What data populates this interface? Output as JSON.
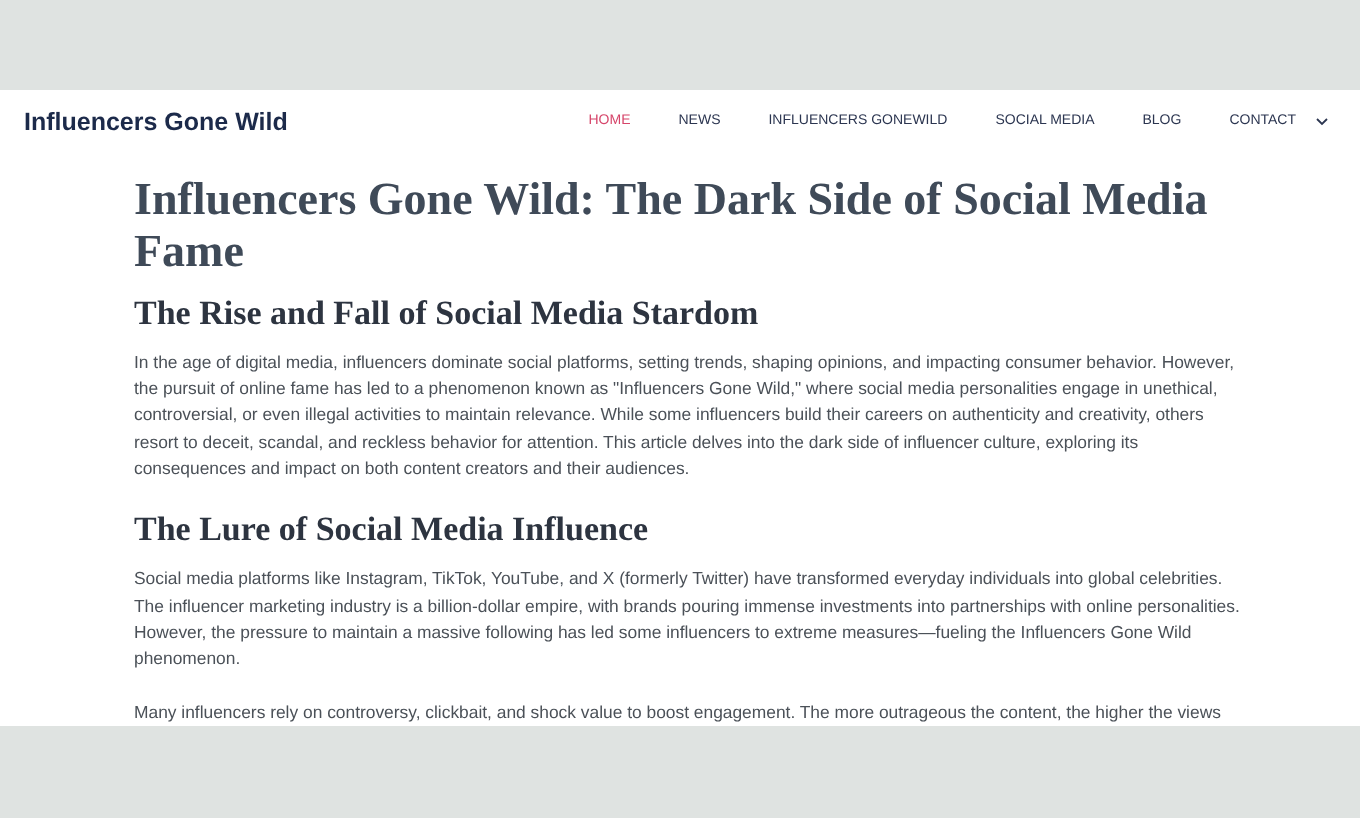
{
  "site_title": "Influencers Gone Wild",
  "nav": [
    {
      "label": "HOME",
      "selected": true
    },
    {
      "label": "NEWS",
      "selected": false
    },
    {
      "label": "INFLUENCERS GONEWILD",
      "selected": false
    },
    {
      "label": "SOCIAL MEDIA",
      "selected": false
    },
    {
      "label": "BLOG",
      "selected": false
    },
    {
      "label": "CONTACT",
      "selected": false,
      "dropdown": true
    }
  ],
  "article": {
    "title": "Influencers Gone Wild: The Dark Side of Social Media Fame",
    "sections": [
      {
        "heading": "The Rise and Fall of Social Media Stardom",
        "paragraphs": [
          "In the age of digital media, influencers dominate social platforms, setting trends, shaping opinions, and impacting consumer behavior. However, the pursuit of online fame has led to a phenomenon known as \"Influencers Gone Wild,\" where social media personalities engage in unethical, controversial, or even illegal activities to maintain relevance. While some influencers build their careers on authenticity and creativity, others resort to deceit, scandal, and reckless behavior for attention. This article delves into the dark side of influencer culture, exploring its consequences and impact on both content creators and their audiences."
        ]
      },
      {
        "heading": "The Lure of Social Media Influence",
        "paragraphs": [
          "Social media platforms like Instagram, TikTok, YouTube, and X (formerly Twitter) have transformed everyday individuals into global celebrities. The influencer marketing industry is a billion-dollar empire, with brands pouring immense investments into partnerships with online personalities. However, the pressure to maintain a massive following has led some influencers to extreme measures—fueling the Influencers Gone Wild phenomenon.",
          "Many influencers rely on controversy, clickbait, and shock value to boost engagement. The more outrageous the content, the higher the views"
        ]
      }
    ]
  }
}
